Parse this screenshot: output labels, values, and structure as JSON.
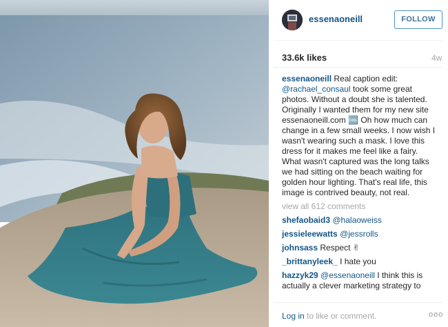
{
  "post": {
    "username": "essenaoneill",
    "follow_label": "FOLLOW",
    "likes": "33.6k likes",
    "age": "4w"
  },
  "caption": {
    "username": "essenaoneill",
    "text_before": "Real caption edit: ",
    "mention": "@rachael_consaul",
    "text_after": " took some great photos. Without a doubt she is talented. Originally I wanted them for my new site essenaoneill.com 🆒 Oh how much can change in a few small weeks. I now wish I wasn't wearing such a mask. I love this dress for it makes me feel like a fairy. What wasn't captured was the long talks we had sitting on the beach waiting for golden hour lighting. That's real life, this image is contrived beauty, not real."
  },
  "view_all": "view all 612 comments",
  "comments": [
    {
      "user": "shefaobaid3",
      "mention": "@halaoweiss",
      "text": ""
    },
    {
      "user": "jessieleewatts",
      "mention": "@jessrolls",
      "text": ""
    },
    {
      "user": "johnsass",
      "mention": "",
      "text": "Respect ✌"
    },
    {
      "user": "_brittanyleek_",
      "mention": "",
      "text": "I hate you"
    },
    {
      "user": "hazzyk29",
      "mention": "@essenaoneill",
      "text": " I think this is actually a clever marketing strategy to"
    }
  ],
  "footer": {
    "login": "Log in",
    "rest": " to like or comment.",
    "more": "ooo"
  },
  "colors": {
    "link": "#125688",
    "muted": "#a5a7aa",
    "dress": "#2f7480",
    "sea": "#8fa6b6"
  }
}
